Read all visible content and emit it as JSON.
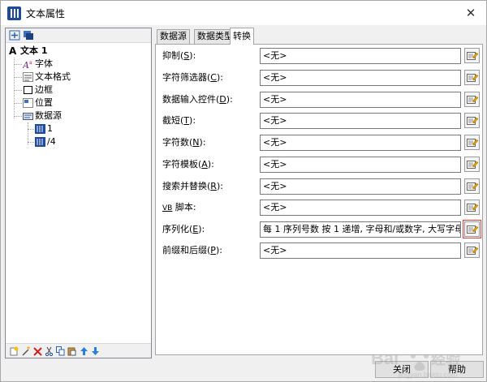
{
  "window": {
    "title": "文本属性",
    "close_glyph": "✕"
  },
  "tree": {
    "root": "文本 1",
    "items": [
      "字体",
      "文本格式",
      "边框",
      "位置",
      "数据源"
    ],
    "sources": [
      "1",
      "/4"
    ]
  },
  "tabs": [
    "数据源",
    "数据类型",
    "转换"
  ],
  "active_tab": "转换",
  "properties": [
    {
      "label": "抑制(",
      "key": "S",
      "suffix": "):",
      "value": "<无>"
    },
    {
      "label": "字符筛选器(",
      "key": "C",
      "suffix": "):",
      "value": "<无>"
    },
    {
      "label": "数据输入控件(",
      "key": "D",
      "suffix": "):",
      "value": "<无>"
    },
    {
      "label": "截短(",
      "key": "T",
      "suffix": "):",
      "value": "<无>"
    },
    {
      "label": "字符数(",
      "key": "N",
      "suffix": "):",
      "value": "<无>"
    },
    {
      "label": "字符模板(",
      "key": "A",
      "suffix": "):",
      "value": "<无>"
    },
    {
      "label": "搜索并替换(",
      "key": "R",
      "suffix": "):",
      "value": "<无>"
    },
    {
      "label": "",
      "key": "VB",
      "suffix": " 脚本:",
      "value": "<无>"
    },
    {
      "label": "序列化(",
      "key": "E",
      "suffix": "):",
      "value": "每 1 序列号数 按 1 递增, 字母和/或数字, 大写字母 ..."
    },
    {
      "label": "前缀和后缀(",
      "key": "P",
      "suffix": "):",
      "value": "<无>"
    }
  ],
  "buttons": {
    "close": "关闭",
    "help": "帮助"
  },
  "colors": {
    "accent": "#1f4a9b",
    "highlight": "#e0393e",
    "window_bg": "#f0f0f0"
  }
}
